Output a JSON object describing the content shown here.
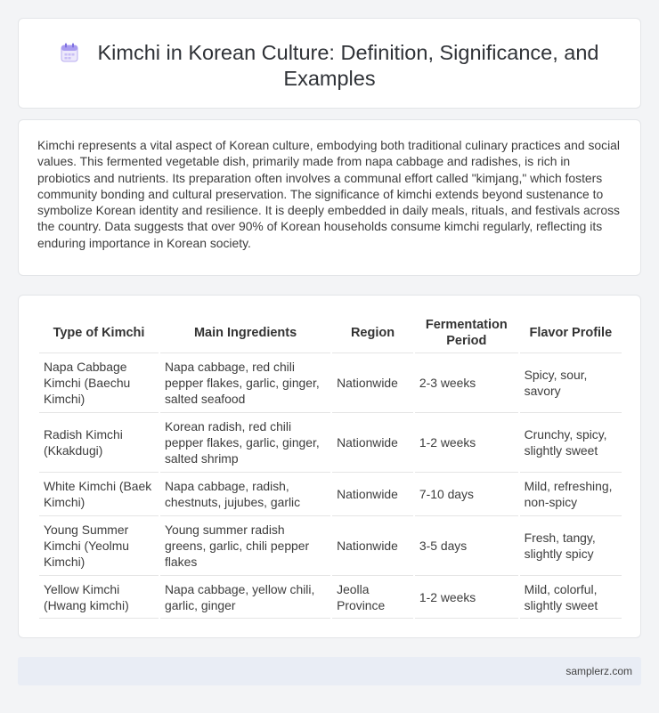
{
  "header": {
    "title": "Kimchi in Korean Culture: Definition, Significance, and Examples"
  },
  "intro": {
    "text": "Kimchi represents a vital aspect of Korean culture, embodying both traditional culinary practices and social values. This fermented vegetable dish, primarily made from napa cabbage and radishes, is rich in probiotics and nutrients. Its preparation often involves a communal effort called \"kimjang,\" which fosters community bonding and cultural preservation. The significance of kimchi extends beyond sustenance to symbolize Korean identity and resilience. It is deeply embedded in daily meals, rituals, and festivals across the country. Data suggests that over 90% of Korean households consume kimchi regularly, reflecting its enduring importance in Korean society."
  },
  "table": {
    "headers": [
      "Type of Kimchi",
      "Main Ingredients",
      "Region",
      "Fermentation Period",
      "Flavor Profile"
    ],
    "rows": [
      [
        "Napa Cabbage Kimchi (Baechu Kimchi)",
        "Napa cabbage, red chili pepper flakes, garlic, ginger, salted seafood",
        "Nationwide",
        "2-3 weeks",
        "Spicy, sour, savory"
      ],
      [
        "Radish Kimchi (Kkakdugi)",
        "Korean radish, red chili pepper flakes, garlic, ginger, salted shrimp",
        "Nationwide",
        "1-2 weeks",
        "Crunchy, spicy, slightly sweet"
      ],
      [
        "White Kimchi (Baek Kimchi)",
        "Napa cabbage, radish, chestnuts, jujubes, garlic",
        "Nationwide",
        "7-10 days",
        "Mild, refreshing, non-spicy"
      ],
      [
        "Young Summer Kimchi (Yeolmu Kimchi)",
        "Young summer radish greens, garlic, chili pepper flakes",
        "Nationwide",
        "3-5 days",
        "Fresh, tangy, slightly spicy"
      ],
      [
        "Yellow Kimchi (Hwang kimchi)",
        "Napa cabbage, yellow chili, garlic, ginger",
        "Jeolla Province",
        "1-2 weeks",
        "Mild, colorful, slightly sweet"
      ]
    ]
  },
  "footer": {
    "site": "samplerz.com"
  }
}
